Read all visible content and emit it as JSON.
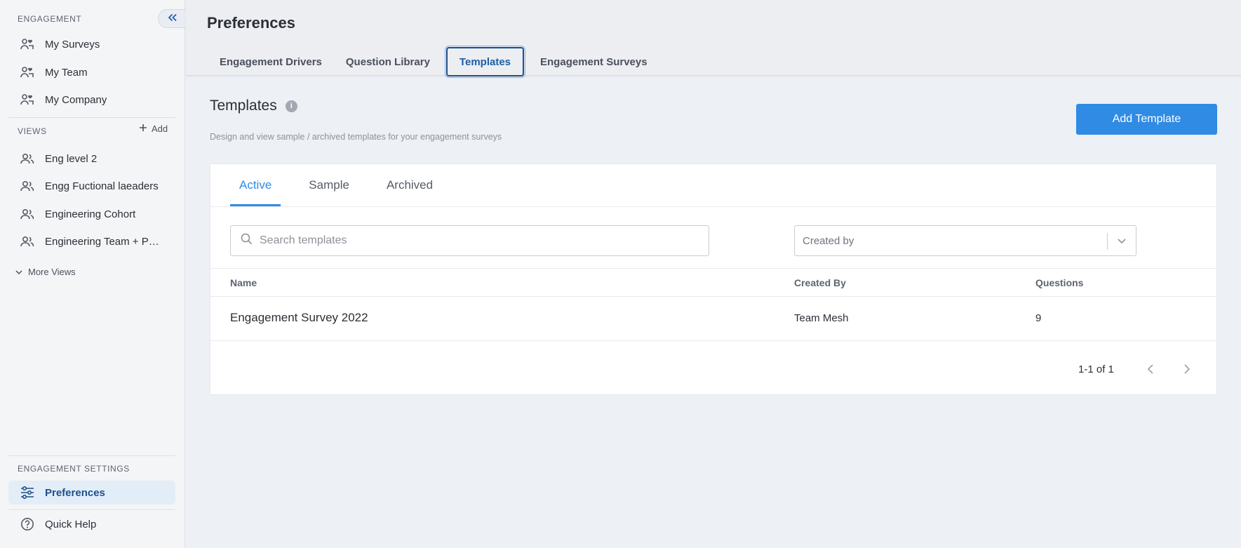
{
  "sidebar": {
    "engagement_label": "ENGAGEMENT",
    "engagement_items": [
      {
        "label": "My Surveys",
        "icon": "people-heart-icon"
      },
      {
        "label": "My Team",
        "icon": "people-heart-icon"
      },
      {
        "label": "My Company",
        "icon": "people-heart-icon"
      }
    ],
    "views_label": "VIEWS",
    "add_label": "Add",
    "view_items": [
      {
        "label": "Eng level 2",
        "icon": "group-icon"
      },
      {
        "label": "Engg Fuctional laeaders",
        "icon": "group-icon"
      },
      {
        "label": "Engineering Cohort",
        "icon": "group-icon"
      },
      {
        "label": "Engineering Team + Peo…",
        "icon": "group-icon"
      }
    ],
    "more_views_label": "More Views",
    "settings_label": "ENGAGEMENT SETTINGS",
    "preferences_label": "Preferences",
    "quick_help_label": "Quick Help"
  },
  "header": {
    "title": "Preferences",
    "tabs": [
      "Engagement Drivers",
      "Question Library",
      "Templates",
      "Engagement Surveys"
    ],
    "active_tab": "Templates"
  },
  "main": {
    "title": "Templates",
    "description": "Design and view sample / archived templates for your engagement surveys",
    "add_button": "Add Template",
    "tabs": [
      "Active",
      "Sample",
      "Archived"
    ],
    "search_placeholder": "Search templates",
    "created_by_placeholder": "Created by",
    "columns": [
      "Name",
      "Created By",
      "Questions"
    ],
    "rows": [
      {
        "name": "Engagement Survey 2022",
        "created_by": "Team Mesh",
        "questions": "9"
      }
    ],
    "pagination": "1-1 of 1"
  },
  "colors": {
    "accent": "#2f8be4",
    "active_nav_bg": "#e3edf8",
    "active_nav_text": "#1c4f8c"
  }
}
